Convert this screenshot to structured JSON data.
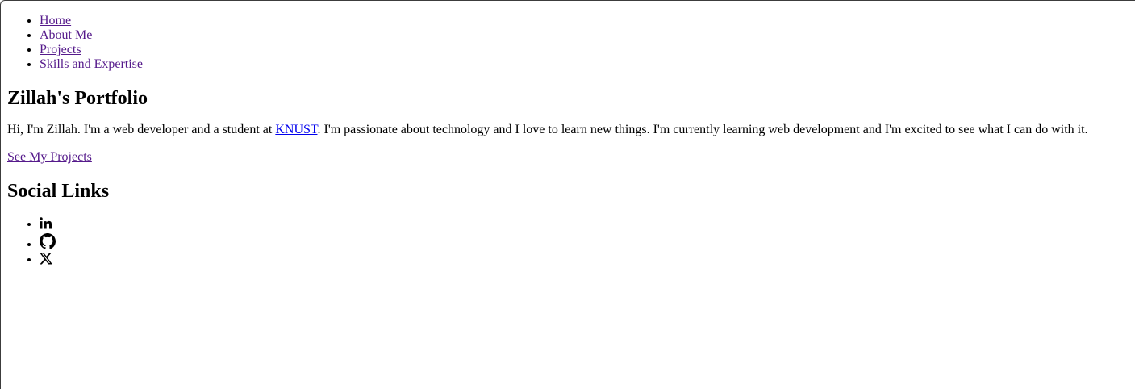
{
  "nav": {
    "items": [
      {
        "label": "Home"
      },
      {
        "label": "About Me"
      },
      {
        "label": "Projects"
      },
      {
        "label": "Skills and Expertise"
      }
    ]
  },
  "hero": {
    "title": "Zillah's Portfolio",
    "intro_before": "Hi, I'm Zillah. I'm a web developer and a student at ",
    "intro_link": "KNUST",
    "intro_after": ". I'm passionate about technology and I love to learn new things. I'm currently learning web development and I'm excited to see what I can do with it.",
    "cta_label": "See My Projects"
  },
  "social": {
    "title": "Social Links",
    "items": [
      {
        "icon": "linkedin-icon"
      },
      {
        "icon": "github-icon"
      },
      {
        "icon": "x-twitter-icon"
      }
    ]
  },
  "colors": {
    "visited_link": "#551a8b",
    "unvisited_link": "#0000ee",
    "text": "#000000"
  }
}
